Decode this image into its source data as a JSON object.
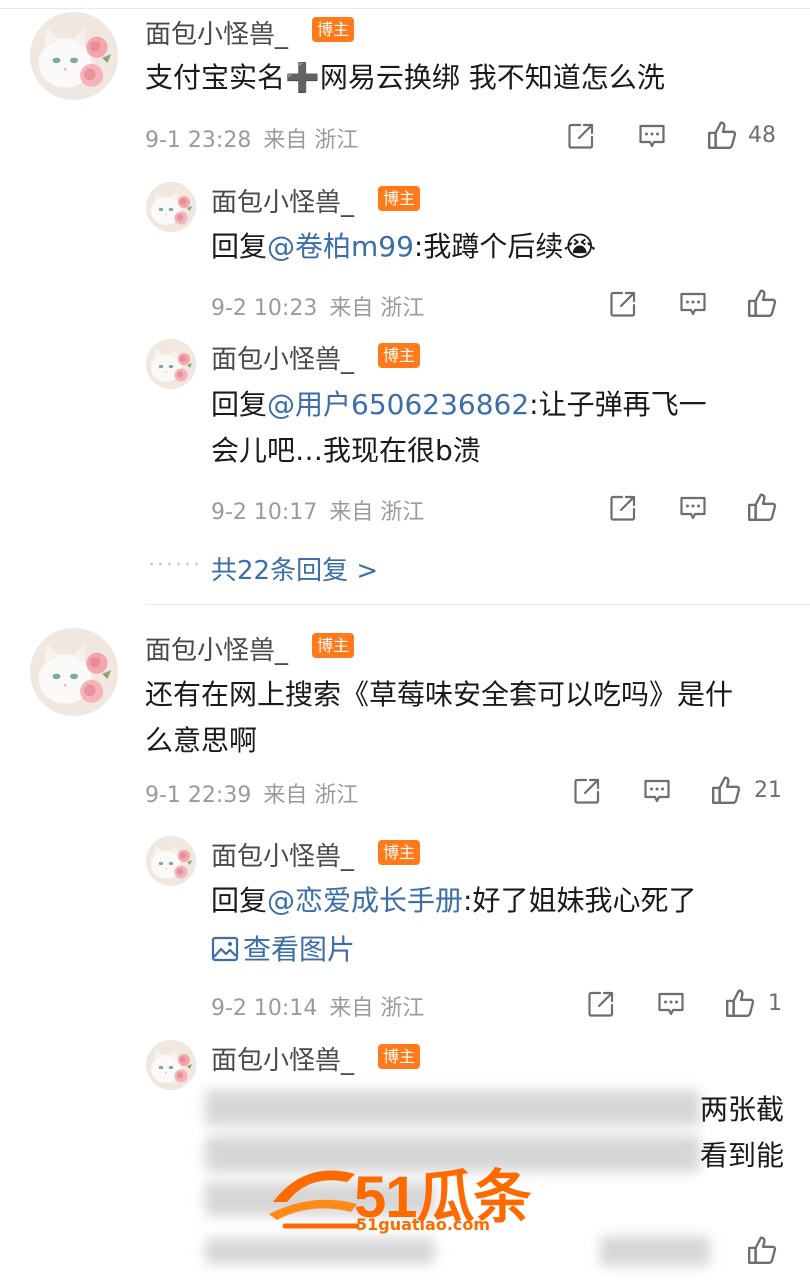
{
  "comments": [
    {
      "username": "面包小怪兽_",
      "badge": "博主",
      "text": "支付宝实名➕网易云换绑 我不知道怎么洗",
      "time": "9-1 23:28",
      "location": "来自 浙江",
      "likes": "48",
      "replies": [
        {
          "username": "面包小怪兽_",
          "badge": "博主",
          "reply_prefix": "回复",
          "mention": "@卷柏m99",
          "text": ":我蹲个后续😭",
          "time": "9-2 10:23",
          "location": "来自 浙江"
        },
        {
          "username": "面包小怪兽_",
          "badge": "博主",
          "reply_prefix": "回复",
          "mention": "@用户6506236862",
          "text_line1": ":让子弹再飞一",
          "text_line2": "会儿吧…我现在很b溃",
          "time": "9-2 10:17",
          "location": "来自 浙江"
        }
      ],
      "more_replies": "共22条回复 >"
    },
    {
      "username": "面包小怪兽_",
      "badge": "博主",
      "text_line1": "还有在网上搜索《草莓味安全套可以吃吗》是什",
      "text_line2": "么意思啊",
      "time": "9-1 22:39",
      "location": "来自 浙江",
      "likes": "21",
      "replies": [
        {
          "username": "面包小怪兽_",
          "badge": "博主",
          "reply_prefix": "回复",
          "mention": "@恋爱成长手册",
          "text": ":好了姐妹我心死了",
          "view_image": "查看图片",
          "time": "9-2 10:14",
          "location": "来自 浙江",
          "likes": "1"
        },
        {
          "username": "面包小怪兽_",
          "badge": "博主",
          "visible_tail_line1": "两张截",
          "visible_tail_line2": "看到能"
        }
      ]
    }
  ],
  "watermark": {
    "brand": "51瓜条",
    "url": "51guatiao.com"
  },
  "icons": {
    "share": "share-icon",
    "comment": "comment-icon",
    "like": "thumbs-up-icon"
  },
  "colors": {
    "mention": "#3d6ea8",
    "badge": "#ff7a1a",
    "meta": "#9a9a9a",
    "watermark": "#ff6a00"
  }
}
